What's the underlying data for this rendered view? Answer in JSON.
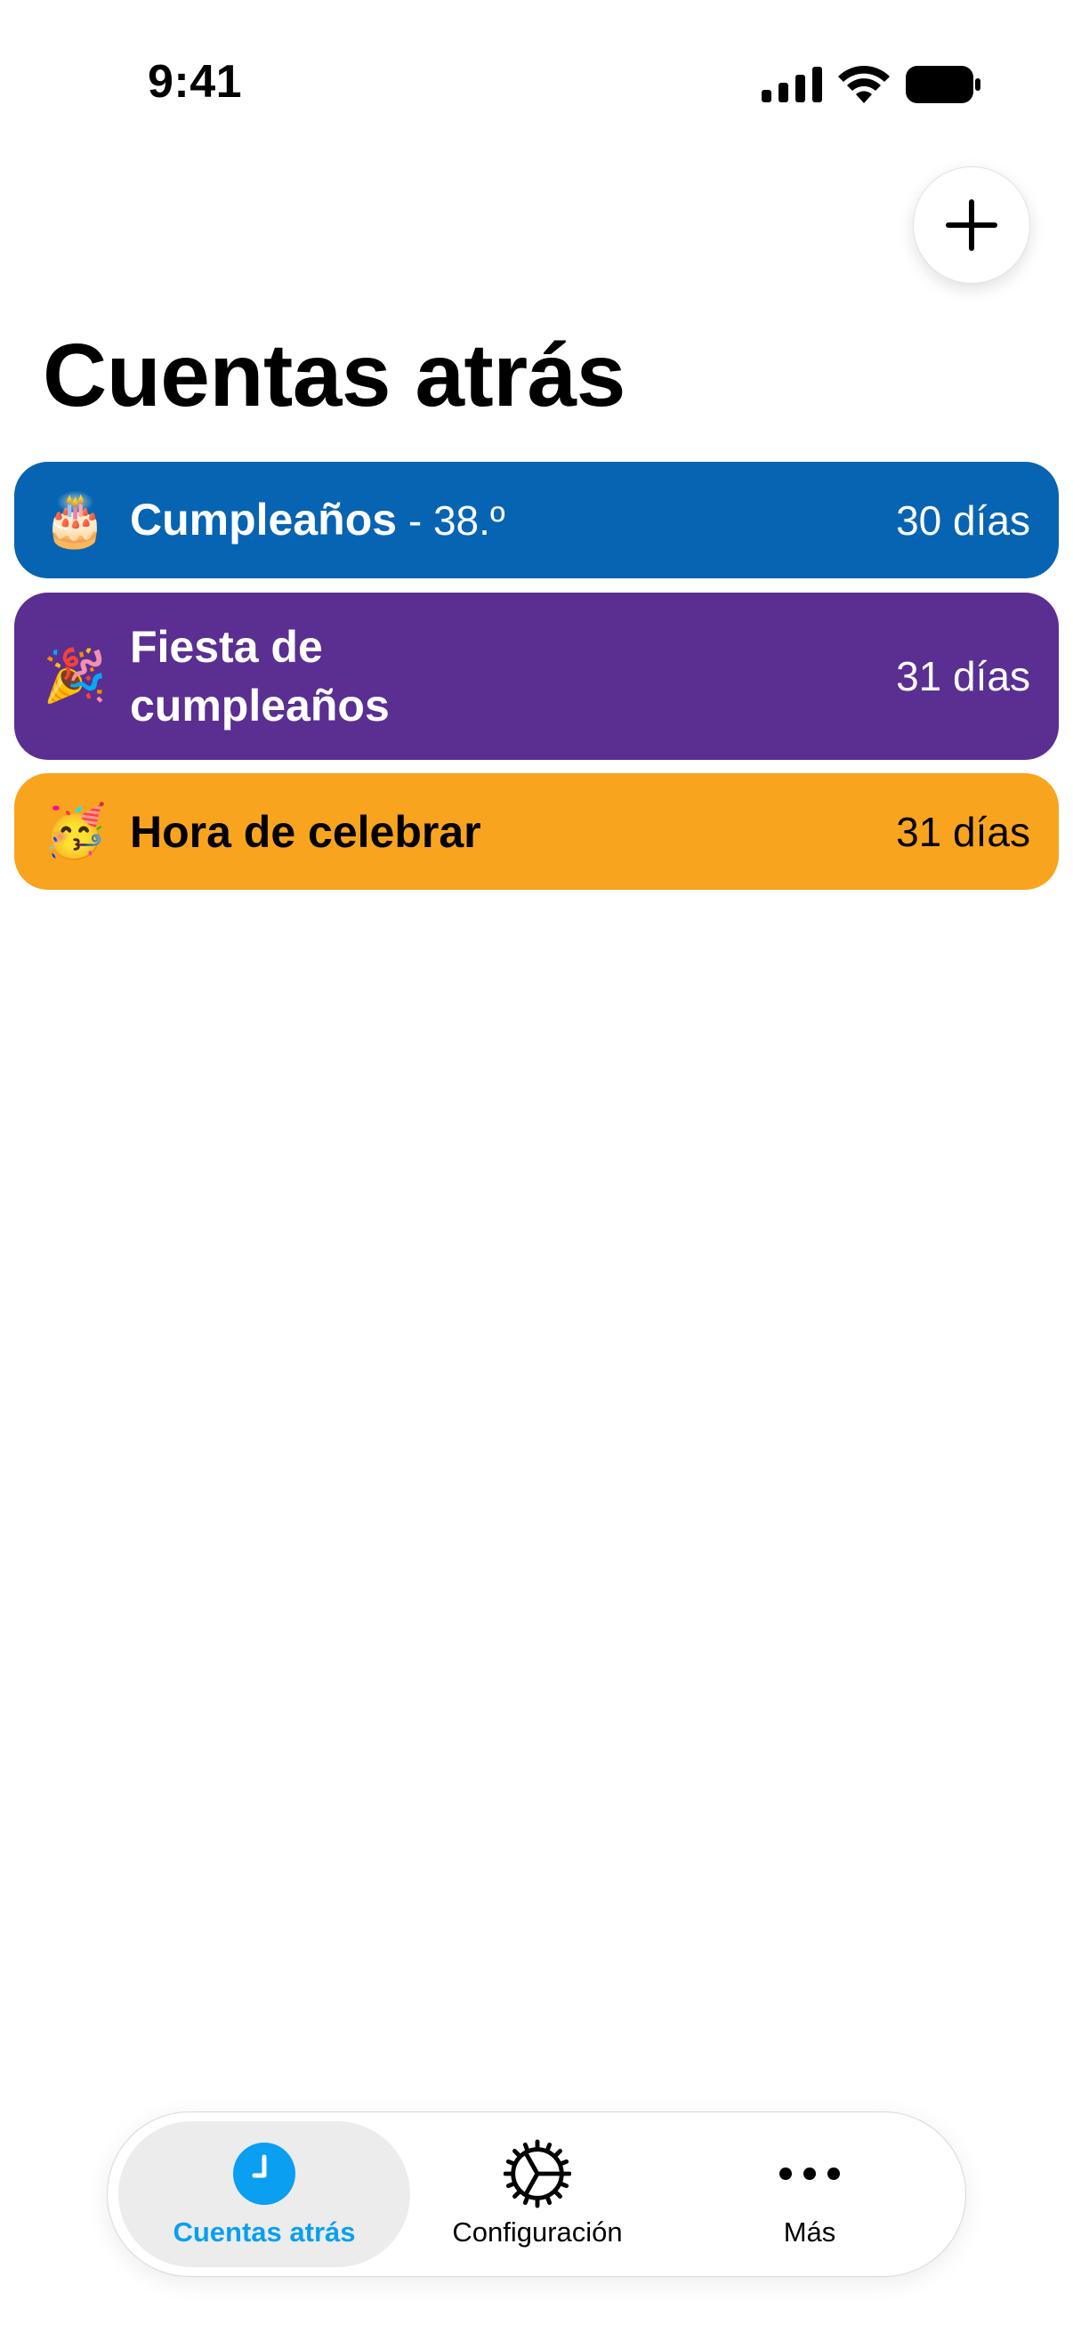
{
  "status_bar": {
    "time": "9:41",
    "icons": [
      "cellular-signal-icon",
      "wifi-icon",
      "battery-icon"
    ]
  },
  "header": {
    "add_icon": "plus-icon",
    "title": "Cuentas atrás"
  },
  "countdowns": [
    {
      "emoji": "🎂",
      "title": "Cumpleaños",
      "subtitle": " - 38.º",
      "days": "30 días",
      "color": "#0764b2",
      "text_color": "#ffffff"
    },
    {
      "emoji": "🎉",
      "title": "Fiesta de cumpleaños",
      "subtitle": "",
      "days": "31 días",
      "color": "#5a2f91",
      "text_color": "#ffffff"
    },
    {
      "emoji": "🥳",
      "title": "Hora de celebrar",
      "subtitle": "",
      "days": "31 días",
      "color": "#f9a41e",
      "text_color": "#000000"
    }
  ],
  "tabbar": {
    "tabs": [
      {
        "label": "Cuentas atrás",
        "icon": "clock-icon",
        "selected": true
      },
      {
        "label": "Configuración",
        "icon": "gear-icon",
        "selected": false
      },
      {
        "label": "Más",
        "icon": "more-icon",
        "selected": false
      }
    ],
    "accent_color": "#0a9ff0"
  }
}
